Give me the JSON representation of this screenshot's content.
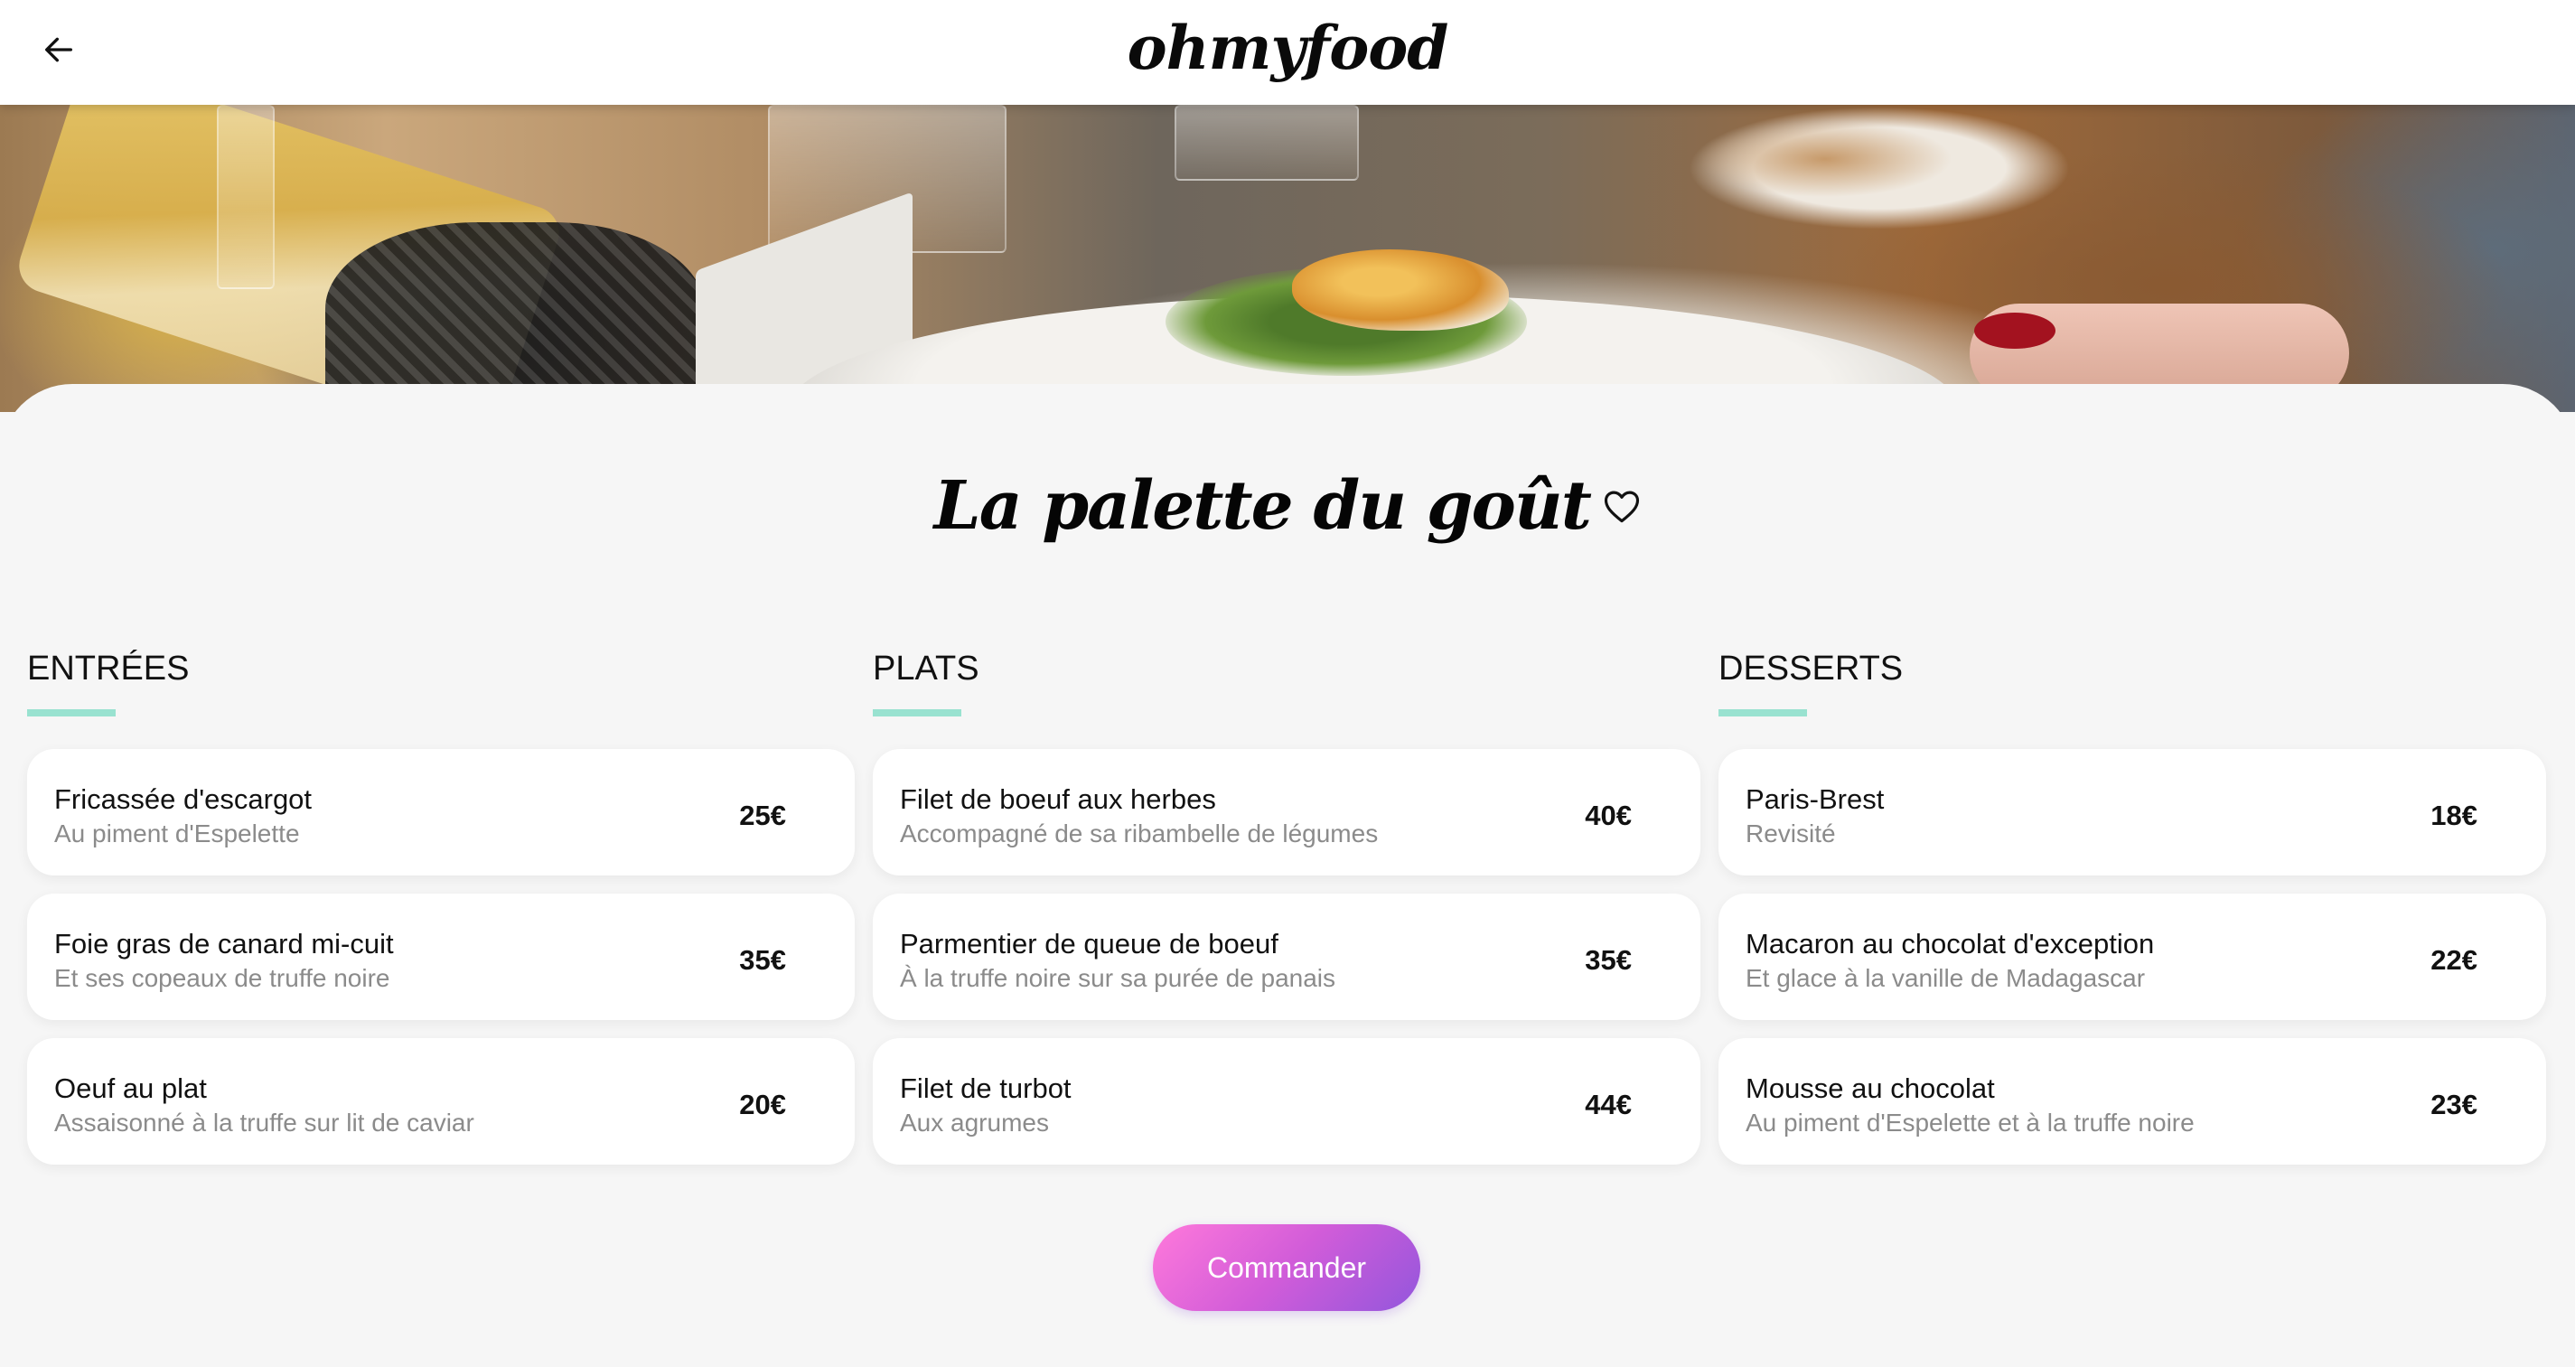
{
  "header": {
    "logo": "ohmyfood",
    "back_icon": "arrow-left-icon"
  },
  "restaurant": {
    "title": "La palette du goût",
    "favorite_icon": "heart-outline-icon"
  },
  "menu": {
    "columns": [
      {
        "title": "ENTRÉES",
        "dishes": [
          {
            "name": "Fricassée d'escargot",
            "description": "Au piment d'Espelette",
            "price": "25€"
          },
          {
            "name": "Foie gras de canard mi-cuit",
            "description": "Et ses copeaux de truffe noire",
            "price": "35€"
          },
          {
            "name": "Oeuf au plat",
            "description": "Assaisonné à la truffe sur lit de caviar",
            "price": "20€"
          }
        ]
      },
      {
        "title": "PLATS",
        "dishes": [
          {
            "name": "Filet de boeuf aux herbes",
            "description": "Accompagné de sa ribambelle de légumes",
            "price": "40€"
          },
          {
            "name": "Parmentier de queue de boeuf",
            "description": "À la truffe noire sur sa purée de panais",
            "price": "35€"
          },
          {
            "name": "Filet de turbot",
            "description": "Aux agrumes",
            "price": "44€"
          }
        ]
      },
      {
        "title": "DESSERTS",
        "dishes": [
          {
            "name": "Paris-Brest",
            "description": "Revisité",
            "price": "18€"
          },
          {
            "name": "Macaron au chocolat d'exception",
            "description": "Et glace à la vanille de Madagascar",
            "price": "22€"
          },
          {
            "name": "Mousse au chocolat",
            "description": "Au piment d'Espelette et à la truffe noire",
            "price": "23€"
          }
        ]
      }
    ]
  },
  "order_button": {
    "label": "Commander"
  },
  "colors": {
    "accent_underline": "#99e2d0",
    "button_gradient_start": "#ff79da",
    "button_gradient_end": "#9356dc",
    "background": "#f6f6f6"
  }
}
